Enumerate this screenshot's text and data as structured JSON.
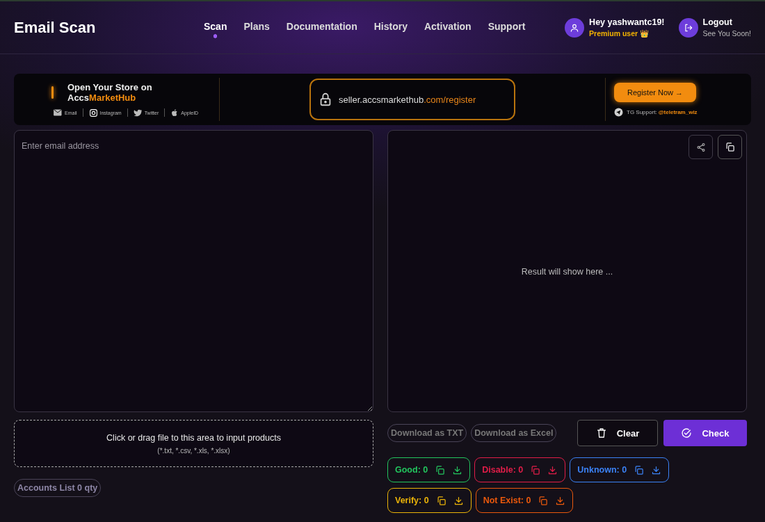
{
  "header": {
    "logo": "Email Scan",
    "nav": [
      {
        "label": "Scan",
        "selected": true
      },
      {
        "label": "Plans",
        "selected": false
      },
      {
        "label": "Documentation",
        "selected": false
      },
      {
        "label": "History",
        "selected": false
      },
      {
        "label": "Activation",
        "selected": false
      },
      {
        "label": "Support",
        "selected": false
      }
    ],
    "user": {
      "greeting": "Hey yashwantc19!",
      "plan": "Premium user 👑"
    },
    "logout": {
      "label": "Logout",
      "subtitle": "See You Soon!"
    }
  },
  "banner": {
    "headline": "Open Your Store on",
    "brand": "Accs**MarketHub**",
    "socials": [
      "Email",
      "Instagram",
      "Twitter",
      "AppleID"
    ],
    "url": "seller.accsmarkethub**.com/register**",
    "cta": "Register Now →",
    "support": "TG Support: **@teletram_wiz**"
  },
  "input": {
    "placeholder": "Enter email address"
  },
  "dropzone": {
    "title": "Click or drag file to this area to input products",
    "formats": "(*.txt, *.csv, *.xls, *.xlsx)"
  },
  "accounts_count": "Accounts List 0 qty",
  "result": {
    "placeholder": "Result will show here ..."
  },
  "downloads": [
    "Download as TXT",
    "Download as Excel"
  ],
  "actions": [
    {
      "label": "Clear",
      "kind": "outline"
    },
    {
      "label": "Check",
      "kind": "primary"
    }
  ],
  "statuses": [
    {
      "label": "Good: 0",
      "color": "#22c55e"
    },
    {
      "label": "Disable: 0",
      "color": "#e11d48"
    },
    {
      "label": "Unknown: 0",
      "color": "#3b82f6"
    },
    {
      "label": "Verify: 0",
      "color": "#eab308"
    },
    {
      "label": "Not Exist: 0",
      "color": "#ea580c"
    }
  ]
}
